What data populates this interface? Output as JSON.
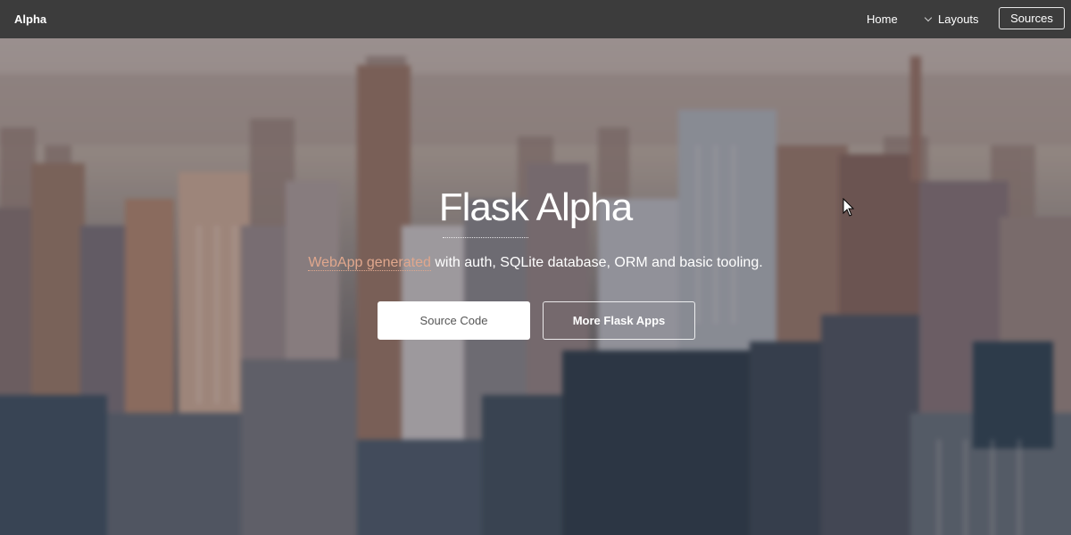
{
  "navbar": {
    "brand": "Alpha",
    "home_label": "Home",
    "layouts_label": "Layouts",
    "sources_label": "Sources",
    "colors": {
      "background": "#3c3c3c",
      "text": "#ffffff"
    }
  },
  "hero": {
    "title": "Flask Alpha",
    "subtitle_link": "WebApp generated",
    "subtitle_rest": " with auth, SQLite database, ORM and basic tooling.",
    "primary_button": "Source Code",
    "secondary_button": "More Flask Apps",
    "colors": {
      "link": "#e0a78d",
      "button_bg": "#ffffff",
      "button_text": "#555555"
    },
    "background_image": "blurred city skyline"
  },
  "icons": {
    "layouts_chevron": "chevron-down-icon",
    "cursor": "mouse-cursor-icon"
  }
}
